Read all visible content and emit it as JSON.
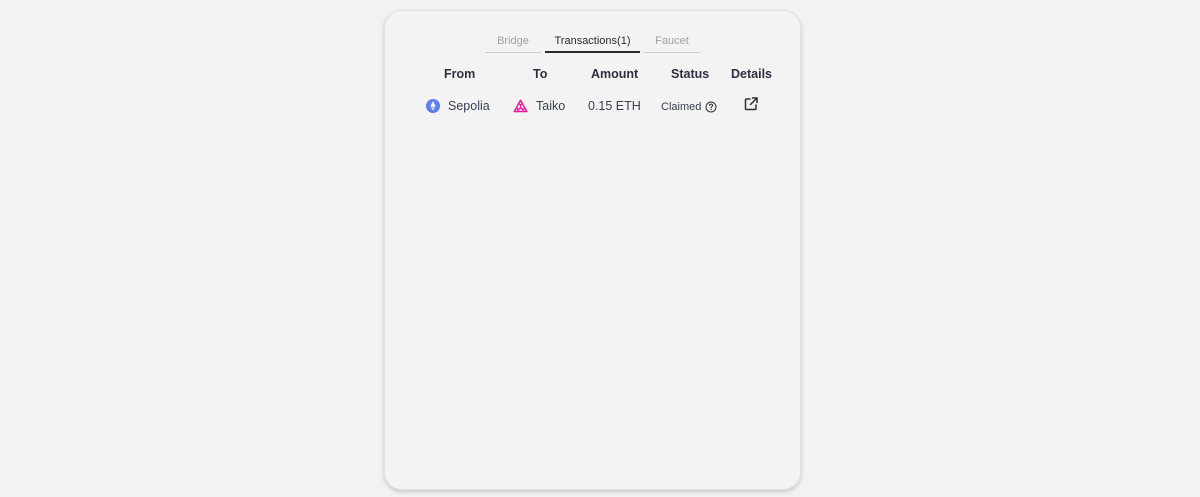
{
  "tabs": [
    {
      "label": "Bridge",
      "active": false
    },
    {
      "label": "Transactions(1)",
      "active": true
    },
    {
      "label": "Faucet",
      "active": false
    }
  ],
  "table": {
    "headers": [
      "From",
      "To",
      "Amount",
      "Status",
      "Details"
    ],
    "rows": [
      {
        "from": "Sepolia",
        "from_icon": "ethereum-icon",
        "to": "Taiko",
        "to_icon": "taiko-icon",
        "amount": "0.15 ETH",
        "status": "Claimed",
        "status_icon": "question-circle-icon",
        "details_icon": "external-link-icon"
      }
    ]
  },
  "colors": {
    "ethereum": "#627eea",
    "taiko": "#e81899",
    "background": "#f2f2f2",
    "card": "#f3f3f3"
  }
}
